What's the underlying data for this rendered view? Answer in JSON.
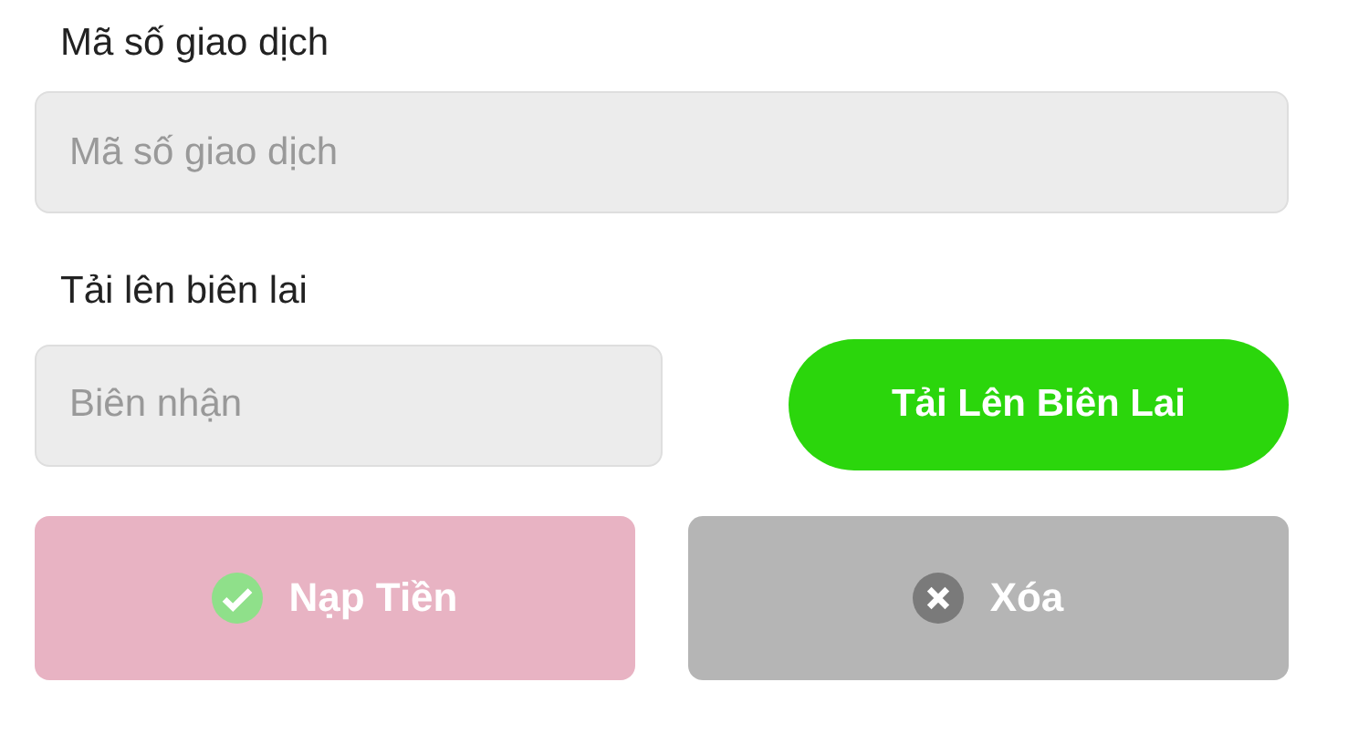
{
  "transaction_id": {
    "label": "Mã số giao dịch",
    "placeholder": "Mã số giao dịch"
  },
  "receipt": {
    "label": "Tải lên biên lai",
    "placeholder": "Biên nhận",
    "upload_button": "Tải Lên Biên Lai"
  },
  "actions": [
    {
      "kind": "submit",
      "label": "Nạp Tiền",
      "disabled": true
    },
    {
      "kind": "clear",
      "label": "Xóa",
      "disabled": false
    }
  ]
}
